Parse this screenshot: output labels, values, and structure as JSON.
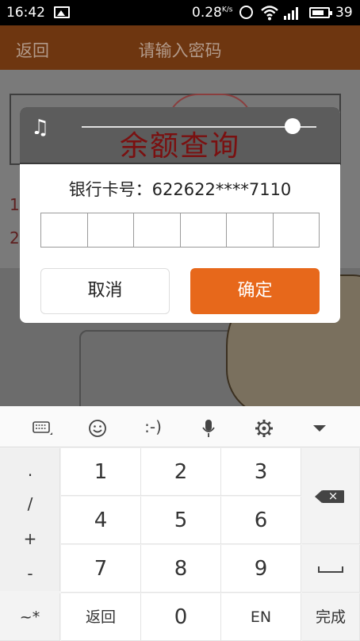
{
  "status_bar": {
    "time": "16:42",
    "net_speed": "0.28",
    "net_speed_unit": "K/s",
    "battery": "39"
  },
  "header": {
    "back_label": "返回",
    "title": "请输入密码"
  },
  "background": {
    "num1": "1",
    "num2": "2"
  },
  "dialog": {
    "overlay_title": "余额查询",
    "card_line": "银行卡号：622622****7110",
    "pin_length": 6,
    "volume_level": 0.9,
    "cancel_label": "取消",
    "confirm_label": "确定",
    "confirm_color": "#e7681b"
  },
  "keyboard": {
    "toolbar": {
      "emoticon": ":-)"
    },
    "symbols": [
      ".",
      "/",
      "+",
      "-"
    ],
    "digits": [
      "1",
      "2",
      "3",
      "4",
      "5",
      "6",
      "7",
      "8",
      "9"
    ],
    "bottom": {
      "mode_key": "~*",
      "back_key": "返回",
      "zero_key": "0",
      "lang_key": "EN",
      "done_key": "完成"
    }
  }
}
